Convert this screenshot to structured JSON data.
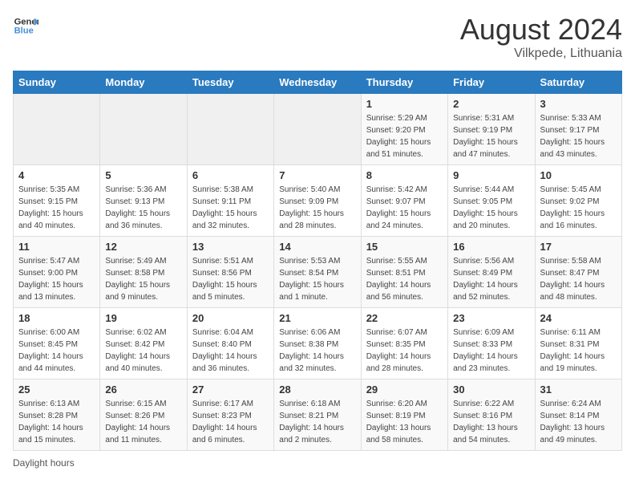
{
  "logo": {
    "line1": "General",
    "line2": "Blue"
  },
  "title": "August 2024",
  "location": "Vilkpede, Lithuania",
  "days_of_week": [
    "Sunday",
    "Monday",
    "Tuesday",
    "Wednesday",
    "Thursday",
    "Friday",
    "Saturday"
  ],
  "footer": "Daylight hours",
  "weeks": [
    [
      {
        "day": "",
        "info": ""
      },
      {
        "day": "",
        "info": ""
      },
      {
        "day": "",
        "info": ""
      },
      {
        "day": "",
        "info": ""
      },
      {
        "day": "1",
        "info": "Sunrise: 5:29 AM\nSunset: 9:20 PM\nDaylight: 15 hours\nand 51 minutes."
      },
      {
        "day": "2",
        "info": "Sunrise: 5:31 AM\nSunset: 9:19 PM\nDaylight: 15 hours\nand 47 minutes."
      },
      {
        "day": "3",
        "info": "Sunrise: 5:33 AM\nSunset: 9:17 PM\nDaylight: 15 hours\nand 43 minutes."
      }
    ],
    [
      {
        "day": "4",
        "info": "Sunrise: 5:35 AM\nSunset: 9:15 PM\nDaylight: 15 hours\nand 40 minutes."
      },
      {
        "day": "5",
        "info": "Sunrise: 5:36 AM\nSunset: 9:13 PM\nDaylight: 15 hours\nand 36 minutes."
      },
      {
        "day": "6",
        "info": "Sunrise: 5:38 AM\nSunset: 9:11 PM\nDaylight: 15 hours\nand 32 minutes."
      },
      {
        "day": "7",
        "info": "Sunrise: 5:40 AM\nSunset: 9:09 PM\nDaylight: 15 hours\nand 28 minutes."
      },
      {
        "day": "8",
        "info": "Sunrise: 5:42 AM\nSunset: 9:07 PM\nDaylight: 15 hours\nand 24 minutes."
      },
      {
        "day": "9",
        "info": "Sunrise: 5:44 AM\nSunset: 9:05 PM\nDaylight: 15 hours\nand 20 minutes."
      },
      {
        "day": "10",
        "info": "Sunrise: 5:45 AM\nSunset: 9:02 PM\nDaylight: 15 hours\nand 16 minutes."
      }
    ],
    [
      {
        "day": "11",
        "info": "Sunrise: 5:47 AM\nSunset: 9:00 PM\nDaylight: 15 hours\nand 13 minutes."
      },
      {
        "day": "12",
        "info": "Sunrise: 5:49 AM\nSunset: 8:58 PM\nDaylight: 15 hours\nand 9 minutes."
      },
      {
        "day": "13",
        "info": "Sunrise: 5:51 AM\nSunset: 8:56 PM\nDaylight: 15 hours\nand 5 minutes."
      },
      {
        "day": "14",
        "info": "Sunrise: 5:53 AM\nSunset: 8:54 PM\nDaylight: 15 hours\nand 1 minute."
      },
      {
        "day": "15",
        "info": "Sunrise: 5:55 AM\nSunset: 8:51 PM\nDaylight: 14 hours\nand 56 minutes."
      },
      {
        "day": "16",
        "info": "Sunrise: 5:56 AM\nSunset: 8:49 PM\nDaylight: 14 hours\nand 52 minutes."
      },
      {
        "day": "17",
        "info": "Sunrise: 5:58 AM\nSunset: 8:47 PM\nDaylight: 14 hours\nand 48 minutes."
      }
    ],
    [
      {
        "day": "18",
        "info": "Sunrise: 6:00 AM\nSunset: 8:45 PM\nDaylight: 14 hours\nand 44 minutes."
      },
      {
        "day": "19",
        "info": "Sunrise: 6:02 AM\nSunset: 8:42 PM\nDaylight: 14 hours\nand 40 minutes."
      },
      {
        "day": "20",
        "info": "Sunrise: 6:04 AM\nSunset: 8:40 PM\nDaylight: 14 hours\nand 36 minutes."
      },
      {
        "day": "21",
        "info": "Sunrise: 6:06 AM\nSunset: 8:38 PM\nDaylight: 14 hours\nand 32 minutes."
      },
      {
        "day": "22",
        "info": "Sunrise: 6:07 AM\nSunset: 8:35 PM\nDaylight: 14 hours\nand 28 minutes."
      },
      {
        "day": "23",
        "info": "Sunrise: 6:09 AM\nSunset: 8:33 PM\nDaylight: 14 hours\nand 23 minutes."
      },
      {
        "day": "24",
        "info": "Sunrise: 6:11 AM\nSunset: 8:31 PM\nDaylight: 14 hours\nand 19 minutes."
      }
    ],
    [
      {
        "day": "25",
        "info": "Sunrise: 6:13 AM\nSunset: 8:28 PM\nDaylight: 14 hours\nand 15 minutes."
      },
      {
        "day": "26",
        "info": "Sunrise: 6:15 AM\nSunset: 8:26 PM\nDaylight: 14 hours\nand 11 minutes."
      },
      {
        "day": "27",
        "info": "Sunrise: 6:17 AM\nSunset: 8:23 PM\nDaylight: 14 hours\nand 6 minutes."
      },
      {
        "day": "28",
        "info": "Sunrise: 6:18 AM\nSunset: 8:21 PM\nDaylight: 14 hours\nand 2 minutes."
      },
      {
        "day": "29",
        "info": "Sunrise: 6:20 AM\nSunset: 8:19 PM\nDaylight: 13 hours\nand 58 minutes."
      },
      {
        "day": "30",
        "info": "Sunrise: 6:22 AM\nSunset: 8:16 PM\nDaylight: 13 hours\nand 54 minutes."
      },
      {
        "day": "31",
        "info": "Sunrise: 6:24 AM\nSunset: 8:14 PM\nDaylight: 13 hours\nand 49 minutes."
      }
    ]
  ]
}
